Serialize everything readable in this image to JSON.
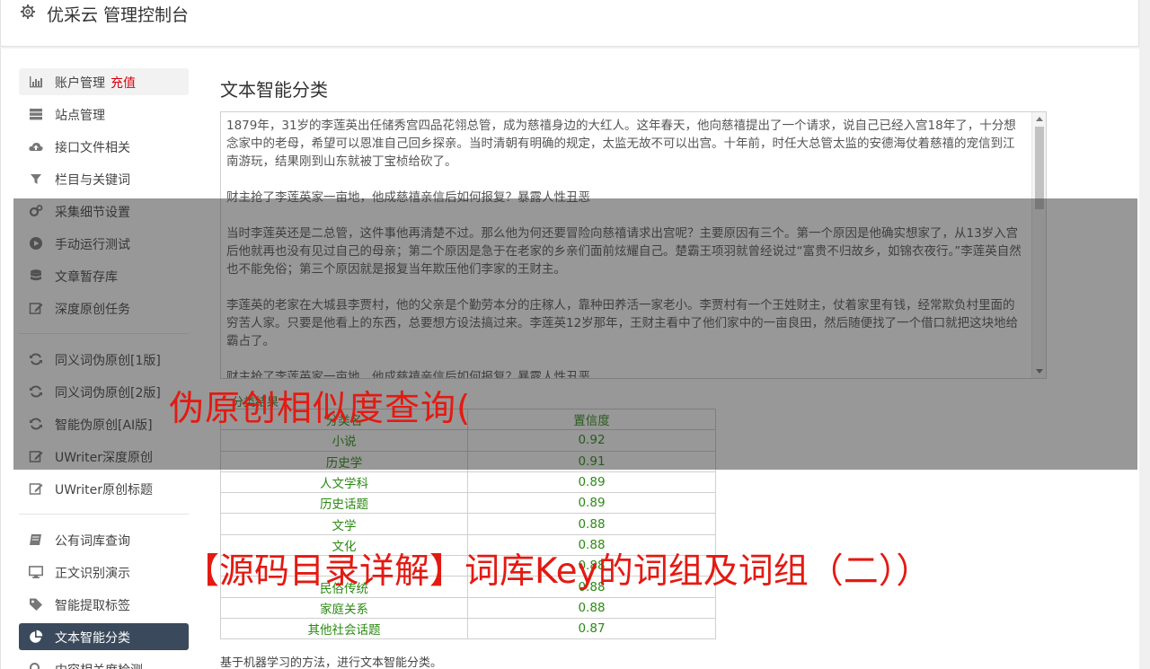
{
  "app": {
    "title": "优采云 管理控制台"
  },
  "sidebar": {
    "items": [
      {
        "label": "账户管理",
        "extra": "充值",
        "icon": "bar-chart-icon"
      },
      {
        "label": "站点管理",
        "icon": "server-icon"
      },
      {
        "label": "接口文件相关",
        "icon": "cloud-upload-icon"
      },
      {
        "label": "栏目与关键词",
        "icon": "filter-icon"
      },
      {
        "label": "采集细节设置",
        "icon": "cogs-icon"
      },
      {
        "label": "手动运行测试",
        "icon": "play-circle-icon"
      },
      {
        "label": "文章暂存库",
        "icon": "database-icon"
      },
      {
        "label": "深度原创任务",
        "icon": "edit-icon"
      },
      {
        "label": "同义词伪原创[1版]",
        "icon": "refresh-icon"
      },
      {
        "label": "同义词伪原创[2版]",
        "icon": "refresh-icon"
      },
      {
        "label": "智能伪原创[AI版]",
        "icon": "refresh-icon"
      },
      {
        "label": "UWriter深度原创",
        "icon": "edit-icon"
      },
      {
        "label": "UWriter原创标题",
        "icon": "edit-icon"
      },
      {
        "label": "公有词库查询",
        "icon": "book-icon"
      },
      {
        "label": "正文识别演示",
        "icon": "desktop-icon"
      },
      {
        "label": "智能提取标签",
        "icon": "tag-icon"
      },
      {
        "label": "文本智能分类",
        "icon": "pie-chart-icon"
      },
      {
        "label": "内容相关度检测",
        "icon": "search-icon"
      }
    ]
  },
  "main": {
    "title": "文本智能分类",
    "paragraphs": [
      "1879年，31岁的李莲英出任储秀宫四品花翎总管，成为慈禧身边的大红人。这年春天，他向慈禧提出了一个请求，说自己已经入宫18年了，十分想念家中的老母，希望可以恩准自己回乡探亲。当时清朝有明确的规定，太监无故不可以出宫。十年前，时任大总管太监的安德海仗着慈禧的宠信到江南游玩，结果刚到山东就被丁宝桢给砍了。",
      "财主抢了李莲英家一亩地，他成慈禧亲信后如何报复？暴露人性丑恶",
      "当时李莲英还是二总管，这件事他再清楚不过。那么他为何还要冒险向慈禧请求出宫呢？主要原因有三个。第一个原因是他确实想家了，从13岁入宫后他就再也没有见过自己的母亲；第二个原因是急于在老家的乡亲们面前炫耀自己。楚霸王项羽就曾经说过“富贵不归故乡，如锦衣夜行。”李莲英自然也不能免俗；第三个原因就是报复当年欺压他们李家的王财主。",
      "李莲英的老家在大城县李贾村，他的父亲是个勤劳本分的庄稼人，靠种田养活一家老小。李贾村有一个王姓财主，仗着家里有钱，经常欺负村里面的穷苦人家。只要是他看上的东西，总要想方设法搞过来。李莲英12岁那年，王财主看中了他们家中的一亩良田，然后随便找了一个借口就把这块地给霸占了。",
      "财主抢了李莲英家一亩地，他成慈禧亲信后如何报复？暴露人性丑恶"
    ],
    "result_label": "分类结果",
    "table": {
      "headers": [
        "分类名",
        "置信度"
      ],
      "rows": [
        [
          "小说",
          "0.92"
        ],
        [
          "历史学",
          "0.91"
        ],
        [
          "人文学科",
          "0.89"
        ],
        [
          "历史话题",
          "0.89"
        ],
        [
          "文学",
          "0.88"
        ],
        [
          "文化",
          "0.88"
        ],
        [
          "",
          "0.88"
        ],
        [
          "民俗传统",
          "0.88"
        ],
        [
          "家庭关系",
          "0.88"
        ],
        [
          "其他社会话题",
          "0.87"
        ]
      ]
    },
    "footer_note": "基于机器学习的方法，进行文本智能分类。"
  },
  "watermarks": {
    "line1": "伪原创相似度查询(",
    "line2": "【源码目录详解】词库Key的词组及词组（二））"
  },
  "colors": {
    "accent_red": "#e31a12",
    "active_bg": "#3a4a5c",
    "result_green": "#2a8a12"
  }
}
